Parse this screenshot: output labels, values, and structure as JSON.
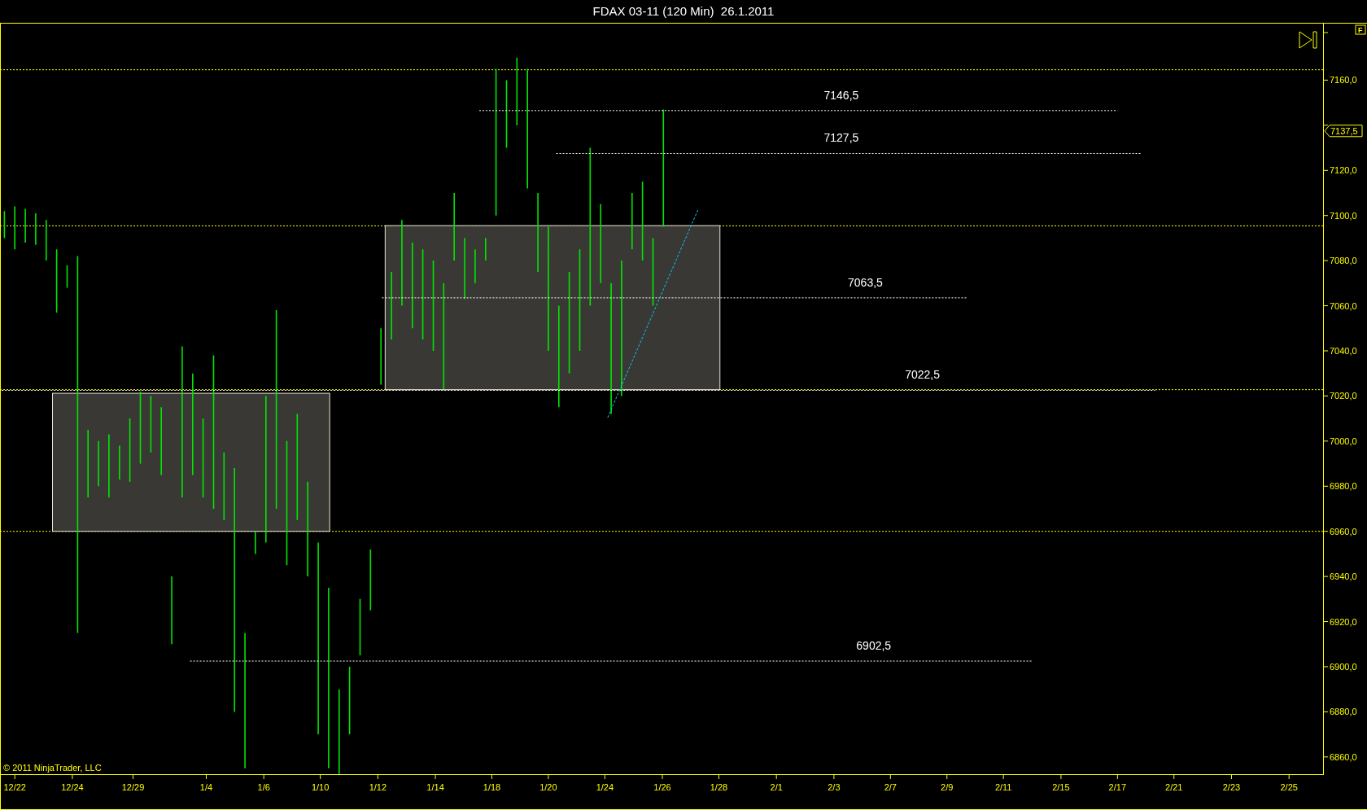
{
  "window": {
    "title": "FDAX 03-11 (120 Min)  26.1.2011"
  },
  "chart": {
    "badge": "F",
    "copyright": "© 2011 NinjaTrader, LLC",
    "current_price": "7137,5",
    "level_labels": [
      "7146,5",
      "7127,5",
      "7063,5",
      "7022,5",
      "6902,5"
    ],
    "price_axis_labels": [
      "7160,0",
      "7120,0",
      "7100,0",
      "7080,0",
      "7060,0",
      "7040,0",
      "7020,0",
      "7000,0",
      "6980,0",
      "6960,0",
      "6940,0",
      "6920,0",
      "6900,0",
      "6880,0",
      "6860,0"
    ],
    "time_axis_labels": [
      "12/22",
      "12/24",
      "12/29",
      "1/4",
      "1/6",
      "1/10",
      "1/12",
      "1/14",
      "1/18",
      "1/20",
      "1/24",
      "1/26",
      "1/28",
      "2/1",
      "2/3",
      "2/7",
      "2/9",
      "2/11",
      "2/15",
      "2/17",
      "2/21",
      "2/23",
      "2/25"
    ]
  }
}
